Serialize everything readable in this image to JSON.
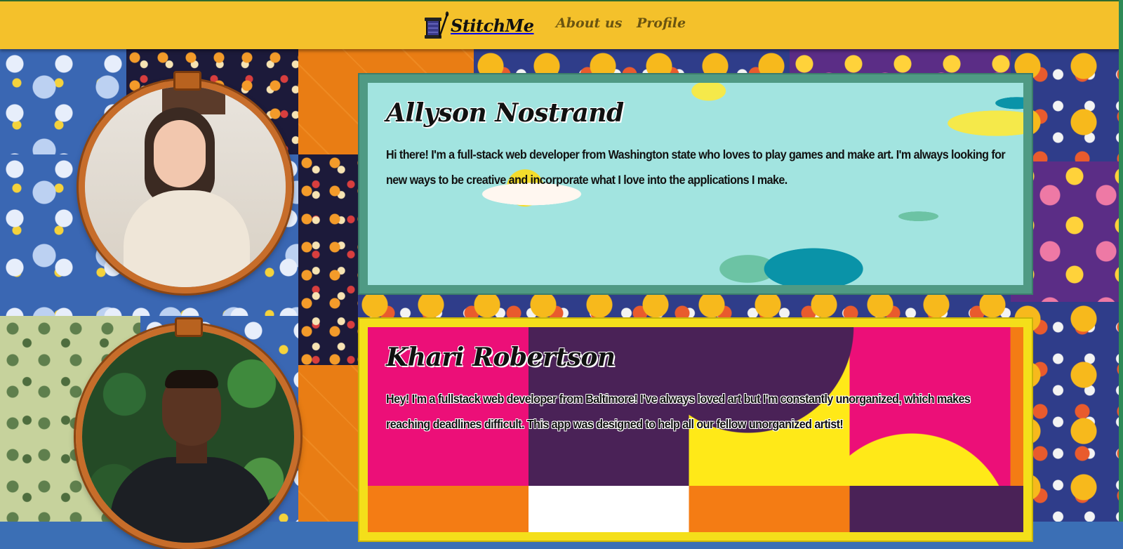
{
  "navbar": {
    "brand": "StitchMe",
    "links": [
      {
        "label": "About us"
      },
      {
        "label": "Profile"
      }
    ]
  },
  "team": [
    {
      "name": "Allyson Nostrand",
      "bio": "Hi there! I'm a full-stack web developer from Washington state who loves to play games and make art. I'm always looking for new ways to be creative and incorporate what I love into the applications I make."
    },
    {
      "name": "Khari Robertson",
      "bio": "Hey! I'm a fullstack web developer from Baltimore! I've always loved art but I'm constantly unorganized, which makes reaching deadlines difficult. This app was designed to help all our fellow unorganized artist!"
    }
  ],
  "colors": {
    "navbar": "#f4c12b",
    "card_1_frame": "#4f9a84",
    "card_1_bg": "#a2e4e0",
    "card_2_frame": "#f4df1a",
    "hoop": "#c76d2a"
  },
  "icons": {
    "logo": "spool-and-needle-icon"
  }
}
